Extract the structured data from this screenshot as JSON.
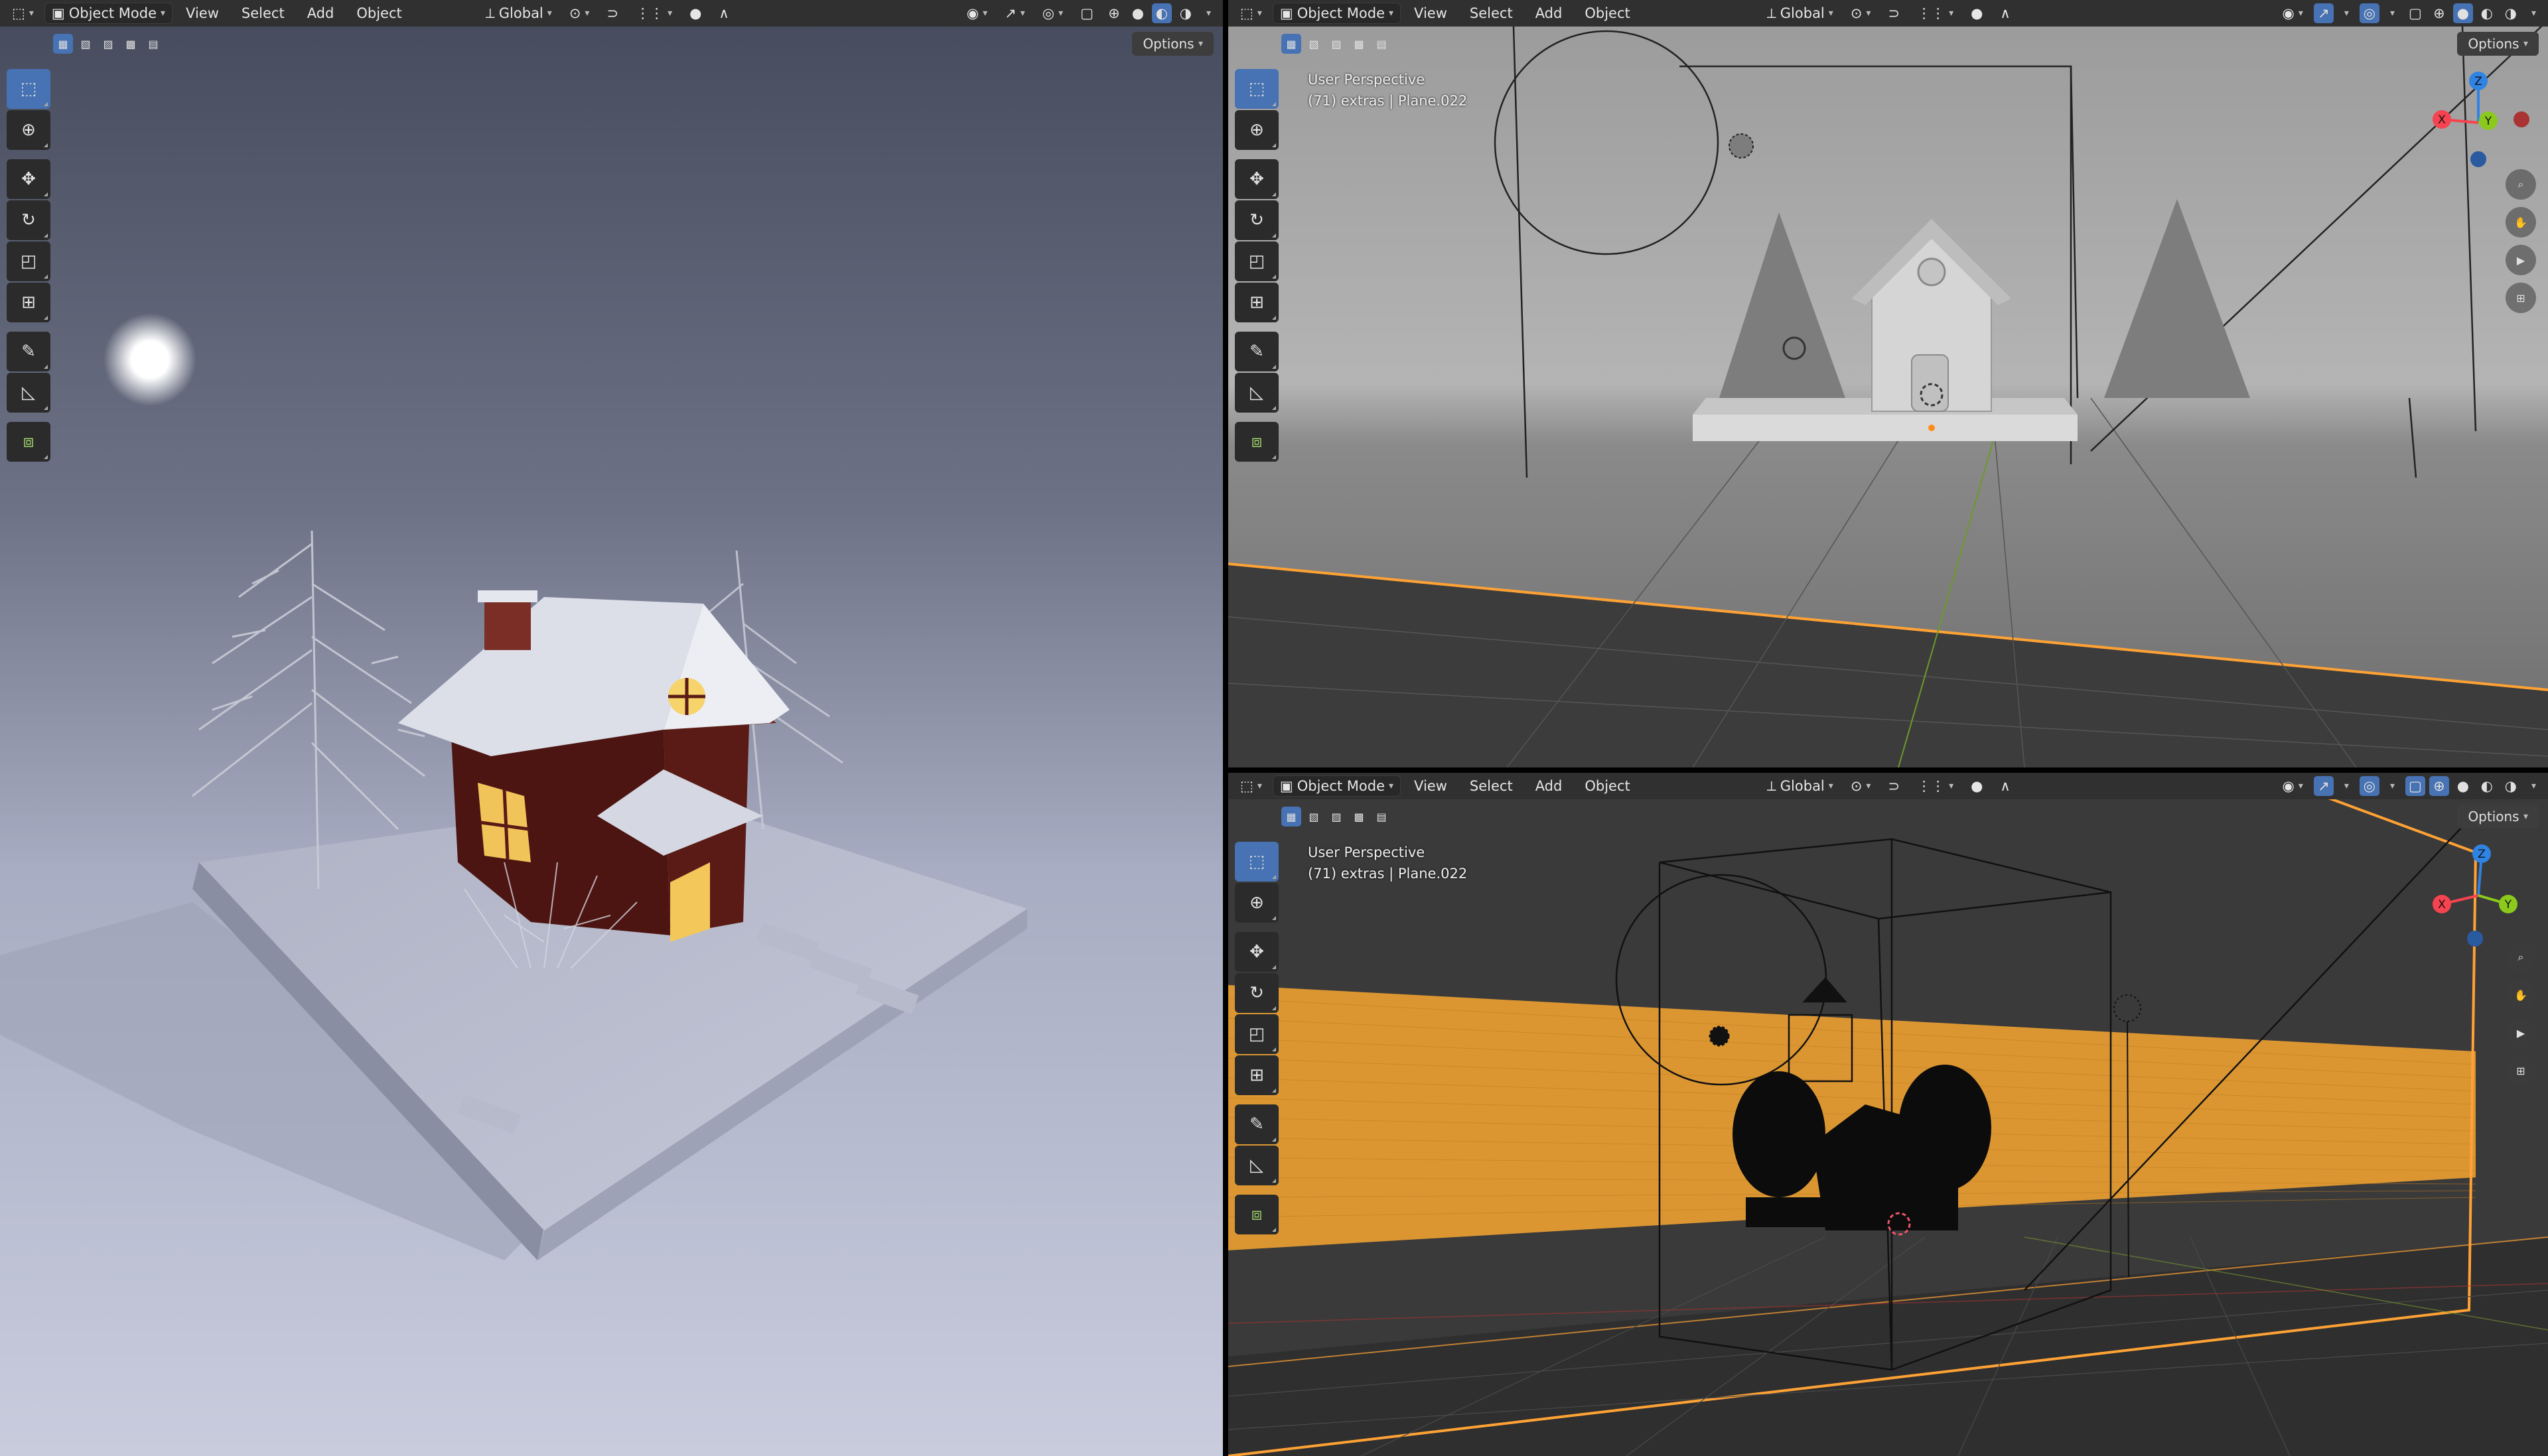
{
  "left_viewport": {
    "mode_label": "Object Mode",
    "menu": [
      "View",
      "Select",
      "Add",
      "Object"
    ],
    "transform_label": "Global",
    "options_label": "Options"
  },
  "top_right_viewport": {
    "mode_label": "Object Mode",
    "menu": [
      "View",
      "Select",
      "Add",
      "Object"
    ],
    "transform_label": "Global",
    "options_label": "Options",
    "view_name": "User Perspective",
    "view_info": "(71) extras | Plane.022"
  },
  "bottom_right_viewport": {
    "mode_label": "Object Mode",
    "menu": [
      "View",
      "Select",
      "Add",
      "Object"
    ],
    "transform_label": "Global",
    "options_label": "Options",
    "view_name": "User Perspective",
    "view_info": "(71) extras | Plane.022"
  },
  "gizmo_axes": {
    "x": "X",
    "y": "Y",
    "z": "Z"
  },
  "tools": [
    "select-box-icon",
    "cursor-icon",
    "move-icon",
    "rotate-icon",
    "scale-icon",
    "transform-icon",
    "annotate-icon",
    "measure-icon",
    "add-cube-icon"
  ],
  "colors": {
    "accent": "#4772b3",
    "selection": "#ffa235",
    "x_axis": "#f5434f",
    "y_axis": "#8bca1c",
    "z_axis": "#2f83e3"
  }
}
